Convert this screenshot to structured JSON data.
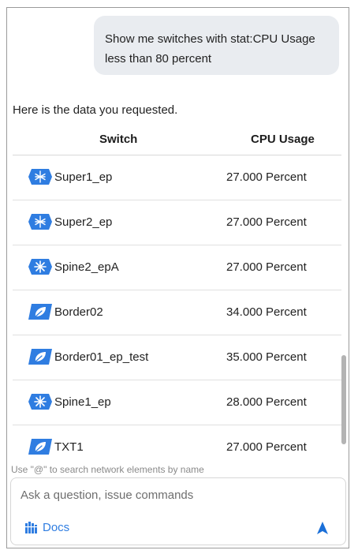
{
  "chat": {
    "user_message": "Show me switches with stat:CPU Usage less than 80 percent",
    "assistant_intro": "Here is the data you requested."
  },
  "table": {
    "headers": {
      "switch": "Switch",
      "cpu": "CPU Usage"
    },
    "rows": [
      {
        "name": "Super1_ep",
        "cpu": "27.000 Percent",
        "icon": "superspine-icon"
      },
      {
        "name": "Super2_ep",
        "cpu": "27.000 Percent",
        "icon": "superspine-icon"
      },
      {
        "name": "Spine2_epA",
        "cpu": "27.000 Percent",
        "icon": "spine-icon"
      },
      {
        "name": "Border02",
        "cpu": "34.000 Percent",
        "icon": "leaf-icon"
      },
      {
        "name": "Border01_ep_test",
        "cpu": "35.000 Percent",
        "icon": "leaf-icon"
      },
      {
        "name": "Spine1_ep",
        "cpu": "28.000 Percent",
        "icon": "spine-icon"
      },
      {
        "name": "TXT1",
        "cpu": "27.000 Percent",
        "icon": "leaf-icon"
      }
    ]
  },
  "composer": {
    "hint": "Use \"@\" to search network elements by name",
    "placeholder": "Ask a question, issue commands",
    "value": "",
    "docs_label": "Docs"
  },
  "colors": {
    "icon_blue": "#2f7de1",
    "bubble_bg": "#e9ecf0",
    "send_blue": "#1a6fd8"
  }
}
